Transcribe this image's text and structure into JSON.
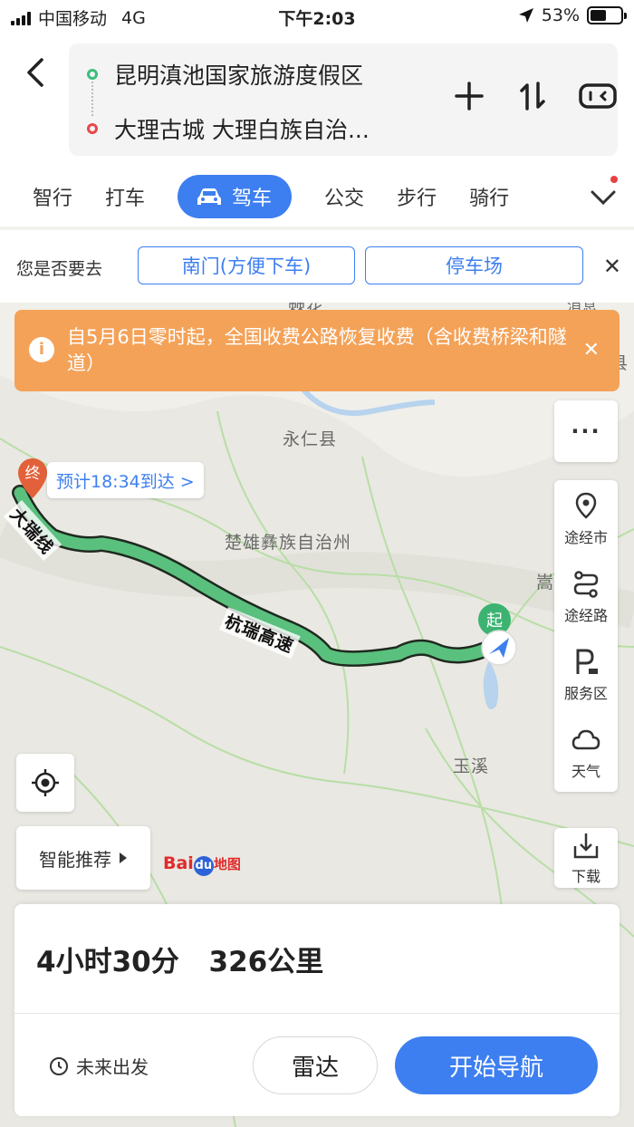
{
  "status_bar": {
    "carrier": "中国移动",
    "network": "4G",
    "time": "下午2:03",
    "battery_text": "53%",
    "battery_level": 0.53
  },
  "route": {
    "start": "昆明滇池国家旅游度假区",
    "end": "大理古城 大理白族自治..."
  },
  "tabs": [
    {
      "label": "智行"
    },
    {
      "label": "打车"
    },
    {
      "label": "驾车",
      "active": true
    },
    {
      "label": "公交"
    },
    {
      "label": "步行"
    },
    {
      "label": "骑行"
    }
  ],
  "suggest": {
    "label": "您是否要去",
    "options": [
      "南门(方便下车)",
      "停车场"
    ]
  },
  "notice": {
    "text": "自5月6日零时起，全国收费公路恢复收费（含收费桥梁和隧道）"
  },
  "map": {
    "places": {
      "yongren": "永仁县",
      "chuxiong": "楚雄彝族自治州",
      "yuxi": "玉溪",
      "top_partial": "棘花",
      "right_partial1": "消息",
      "right_partial2": "县",
      "song_partial": "嵩"
    },
    "roads": {
      "hangrui": "杭瑞高速",
      "left_road": "大瑞线"
    },
    "eta": "预计18:34到达 >",
    "end_marker": "终",
    "start_marker": "起",
    "logo_bai": "Bai",
    "logo_du": "du",
    "logo_ditu": "地图"
  },
  "side_panel": {
    "more": "···",
    "buttons": [
      "途经市",
      "途经路",
      "服务区",
      "天气"
    ],
    "download": "下载"
  },
  "smart_recommend": "智能推荐",
  "summary": {
    "duration": "4小时30分",
    "distance": "326公里"
  },
  "bottom": {
    "future_departure": "未来出发",
    "radar": "雷达",
    "start_nav": "开始导航"
  },
  "colors": {
    "accent": "#3d7ff0",
    "route_green": "#5ac07e",
    "notice_orange": "#f4a258"
  }
}
